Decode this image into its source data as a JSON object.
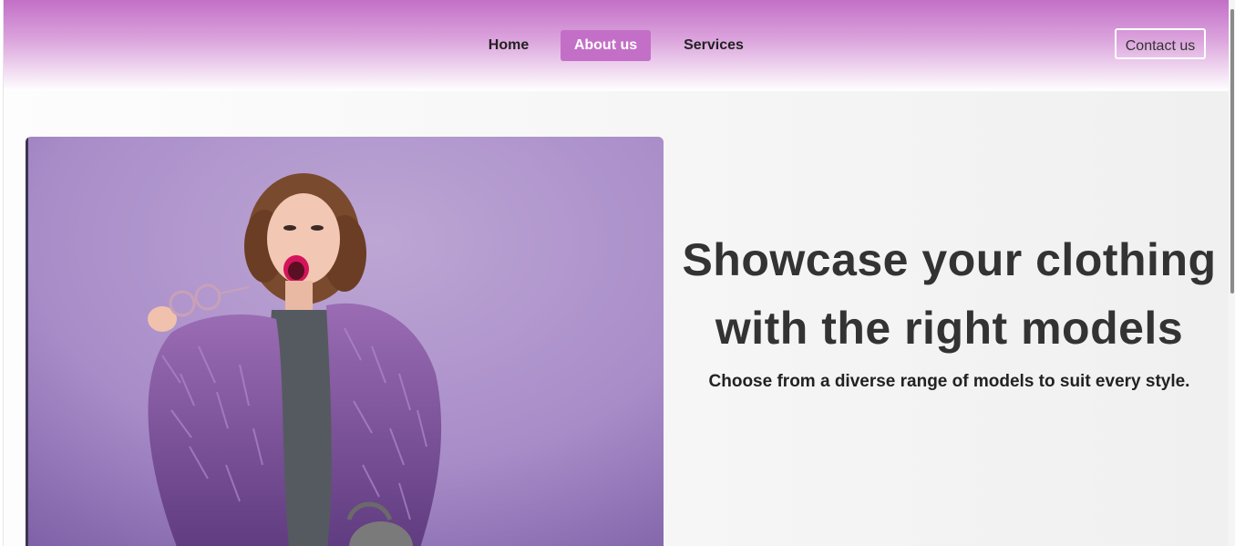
{
  "nav": {
    "items": [
      {
        "label": "Home",
        "active": false
      },
      {
        "label": "About us",
        "active": true
      },
      {
        "label": "Services",
        "active": false
      }
    ],
    "contact_label": "Contact us"
  },
  "hero": {
    "title": "Showcase your clothing with the right models",
    "subtitle": "Choose from a diverse range of models to suit every style.",
    "image": "model-in-purple-fur-coat"
  },
  "colors": {
    "accent": "#c36fc7",
    "image_background": "#a88cc8",
    "coat": "#7d4f99"
  }
}
